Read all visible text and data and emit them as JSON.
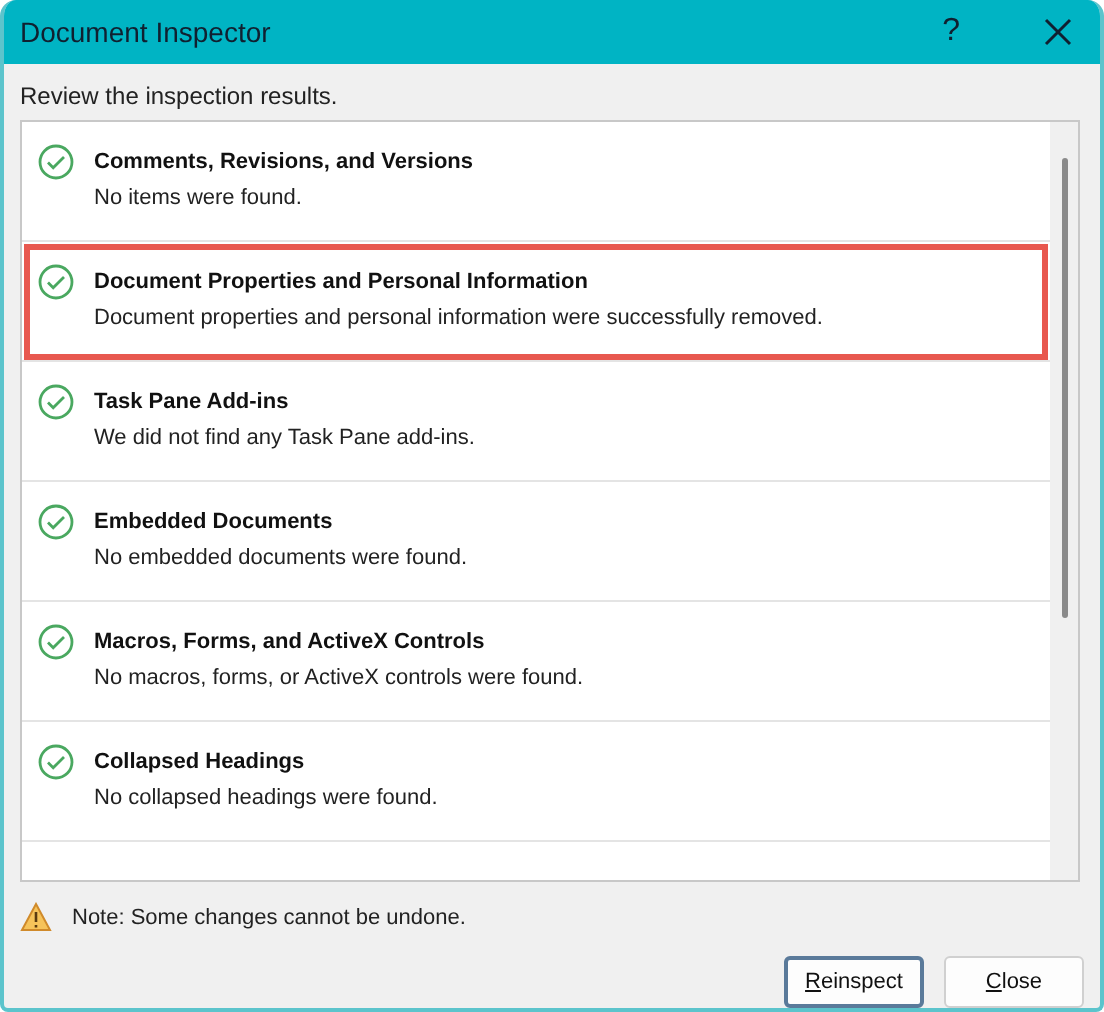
{
  "window": {
    "title": "Document Inspector",
    "help": "?"
  },
  "instruction": "Review the inspection results.",
  "results": [
    {
      "title": "Comments, Revisions, and Versions",
      "detail": "No items were found.",
      "highlighted": false
    },
    {
      "title": "Document Properties and Personal Information",
      "detail": "Document properties and personal information were successfully removed.",
      "highlighted": true
    },
    {
      "title": "Task Pane Add-ins",
      "detail": "We did not find any Task Pane add-ins.",
      "highlighted": false
    },
    {
      "title": "Embedded Documents",
      "detail": "No embedded documents were found.",
      "highlighted": false
    },
    {
      "title": "Macros, Forms, and ActiveX Controls",
      "detail": "No macros, forms, or ActiveX controls were found.",
      "highlighted": false
    },
    {
      "title": "Collapsed Headings",
      "detail": "No collapsed headings were found.",
      "highlighted": false
    }
  ],
  "note": "Note: Some changes cannot be undone.",
  "buttons": [
    {
      "label": "Reinspect",
      "default": true
    },
    {
      "label": "Close",
      "default": false
    }
  ]
}
